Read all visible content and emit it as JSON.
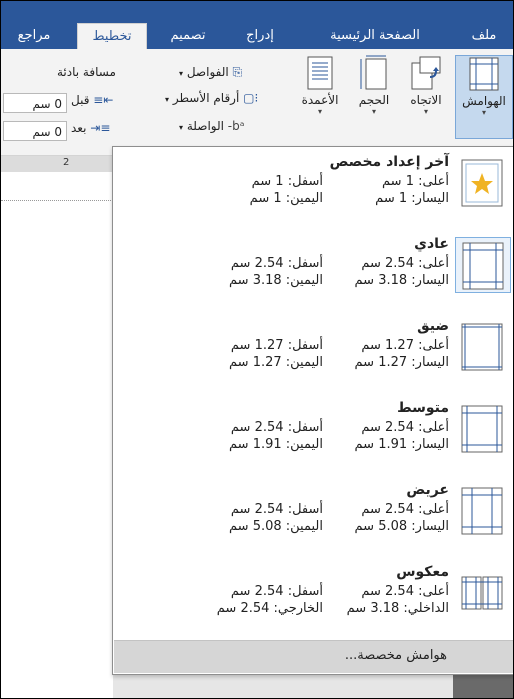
{
  "tabs": [
    {
      "label": "ملف"
    },
    {
      "label": "الصفحة الرئيسية"
    },
    {
      "label": "إدراج"
    },
    {
      "label": "تصميم"
    },
    {
      "label": "تخطيط"
    },
    {
      "label": "مراجع"
    }
  ],
  "ribbon": {
    "margins_label": "الهوامش",
    "orientation_label": "الاتجاه",
    "size_label": "الحجم",
    "columns_label": "الأعمدة",
    "breaks_label": "الفواصل",
    "line_numbers_label": "أرقام الأسطر",
    "hyphenation_label": "الواصلة",
    "indent_title": "مسافة بادئة",
    "before_label": "قبل",
    "after_label": "بعد",
    "before_value": "0 سم",
    "after_value": "0 سم"
  },
  "ruler": {
    "number": "2"
  },
  "margins_menu": {
    "items": [
      {
        "name": "آخر إعداد مخصص",
        "top_label": "أعلى:",
        "top": "1 سم",
        "bottom_label": "أسفل:",
        "bottom": "1 سم",
        "left_label": "اليسار:",
        "left": "1 سم",
        "right_label": "اليمين:",
        "right": "1 سم",
        "icon": "star-page-icon"
      },
      {
        "name": "عادي",
        "top_label": "أعلى:",
        "top": "2.54 سم",
        "bottom_label": "أسفل:",
        "bottom": "2.54 سم",
        "left_label": "اليسار:",
        "left": "3.18 سم",
        "right_label": "اليمين:",
        "right": "3.18 سم",
        "icon": "normal-margins-icon"
      },
      {
        "name": "ضيق",
        "top_label": "أعلى:",
        "top": "1.27 سم",
        "bottom_label": "أسفل:",
        "bottom": "1.27 سم",
        "left_label": "اليسار:",
        "left": "1.27 سم",
        "right_label": "اليمين:",
        "right": "1.27 سم",
        "icon": "narrow-margins-icon"
      },
      {
        "name": "متوسط",
        "top_label": "أعلى:",
        "top": "2.54 سم",
        "bottom_label": "أسفل:",
        "bottom": "2.54 سم",
        "left_label": "اليسار:",
        "left": "1.91 سم",
        "right_label": "اليمين:",
        "right": "1.91 سم",
        "icon": "moderate-margins-icon"
      },
      {
        "name": "عريض",
        "top_label": "أعلى:",
        "top": "2.54 سم",
        "bottom_label": "أسفل:",
        "bottom": "2.54 سم",
        "left_label": "اليسار:",
        "left": "5.08 سم",
        "right_label": "اليمين:",
        "right": "5.08 سم",
        "icon": "wide-margins-icon"
      },
      {
        "name": "معكوس",
        "top_label": "أعلى:",
        "top": "2.54 سم",
        "bottom_label": "أسفل:",
        "bottom": "2.54 سم",
        "left_label": "الداخلي:",
        "left": "3.18 سم",
        "right_label": "الخارجي:",
        "right": "2.54 سم",
        "icon": "mirrored-margins-icon"
      }
    ],
    "custom_label": "هوامش مخصصة..."
  },
  "colors": {
    "accent": "#2b579a",
    "selected": "#c5d9ee",
    "star": "#f0b323"
  }
}
